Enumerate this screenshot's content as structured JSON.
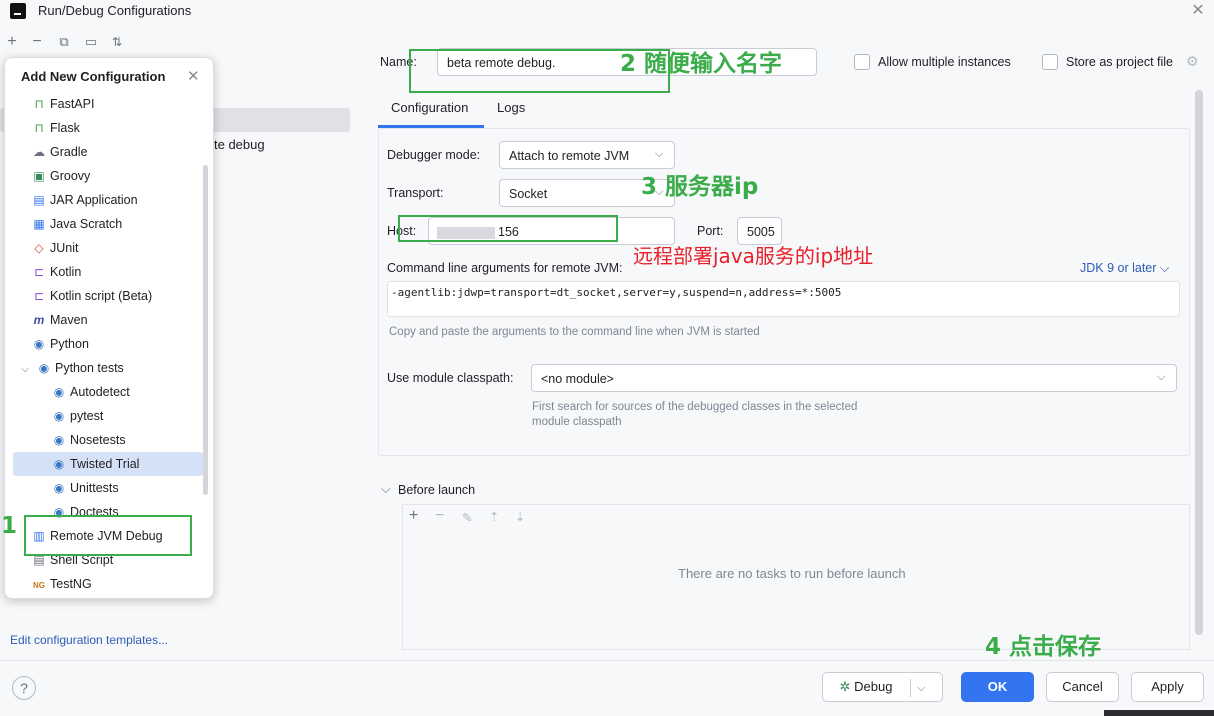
{
  "window": {
    "title": "Run/Debug Configurations"
  },
  "left_toolbar": {
    "icons": [
      "add-icon",
      "remove-icon",
      "copy-icon",
      "folder-icon",
      "sort-icon"
    ]
  },
  "left_list": {
    "item_fragment": "te debug",
    "edit_templates": "Edit configuration templates..."
  },
  "popup": {
    "title": "Add New Configuration",
    "items": [
      {
        "label": "FastAPI",
        "icon": "🔒"
      },
      {
        "label": "Flask",
        "icon": "🔒"
      },
      {
        "label": "Gradle",
        "icon": "⚙"
      },
      {
        "label": "Groovy",
        "icon": "▣"
      },
      {
        "label": "JAR Application",
        "icon": "▤"
      },
      {
        "label": "Java Scratch",
        "icon": "▦"
      },
      {
        "label": "JUnit",
        "icon": "◆"
      },
      {
        "label": "Kotlin",
        "icon": "K"
      },
      {
        "label": "Kotlin script (Beta)",
        "icon": "K"
      },
      {
        "label": "Maven",
        "icon": "m"
      },
      {
        "label": "Python",
        "icon": "◉"
      },
      {
        "label": "Python tests",
        "icon": "◉"
      },
      {
        "label": "Autodetect",
        "icon": "◉"
      },
      {
        "label": "pytest",
        "icon": "◉"
      },
      {
        "label": "Nosetests",
        "icon": "◉"
      },
      {
        "label": "Twisted Trial",
        "icon": "◉"
      },
      {
        "label": "Unittests",
        "icon": "◉"
      },
      {
        "label": "Doctests",
        "icon": "◉"
      },
      {
        "label": "Remote JVM Debug",
        "icon": "▥"
      },
      {
        "label": "Shell Script",
        "icon": "▤"
      },
      {
        "label": "TestNG",
        "icon": "NG"
      }
    ]
  },
  "form": {
    "name_label": "Name:",
    "name_value": "beta  remote debug.",
    "allow_multiple": "Allow multiple instances",
    "store_project": "Store as project file",
    "tabs": [
      "Configuration",
      "Logs"
    ],
    "debugger_mode_label": "Debugger mode:",
    "debugger_mode_value": "Attach to remote JVM",
    "transport_label": "Transport:",
    "transport_value": "Socket",
    "host_label": "Host:",
    "host_value": "156",
    "port_label": "Port:",
    "port_value": "5005",
    "cmd_label": "Command line arguments for remote JVM:",
    "jdk_select": "JDK 9 or later",
    "cmd_value": "-agentlib:jdwp=transport=dt_socket,server=y,suspend=n,address=*:5005",
    "cmd_hint": "Copy and paste the arguments to the command line when JVM is started",
    "module_label": "Use module classpath:",
    "module_value": "<no module>",
    "module_hint_1": "First search for sources of the debugged classes in the selected",
    "module_hint_2": "module classpath",
    "before_launch": "Before launch",
    "no_tasks": "There are no tasks to run before launch"
  },
  "annotations": {
    "step1": "1",
    "step2": "2 随便输入名字",
    "step3": "3  服务器ip",
    "step3_note": "远程部署java服务的ip地址",
    "step4": "4 点击保存"
  },
  "buttons": {
    "help": "?",
    "debug": "Debug",
    "ok": "OK",
    "cancel": "Cancel",
    "apply": "Apply"
  },
  "colors": {
    "annotation_green": "#3aac4a",
    "annotation_red": "#e8202a",
    "accent": "#3574f0"
  }
}
